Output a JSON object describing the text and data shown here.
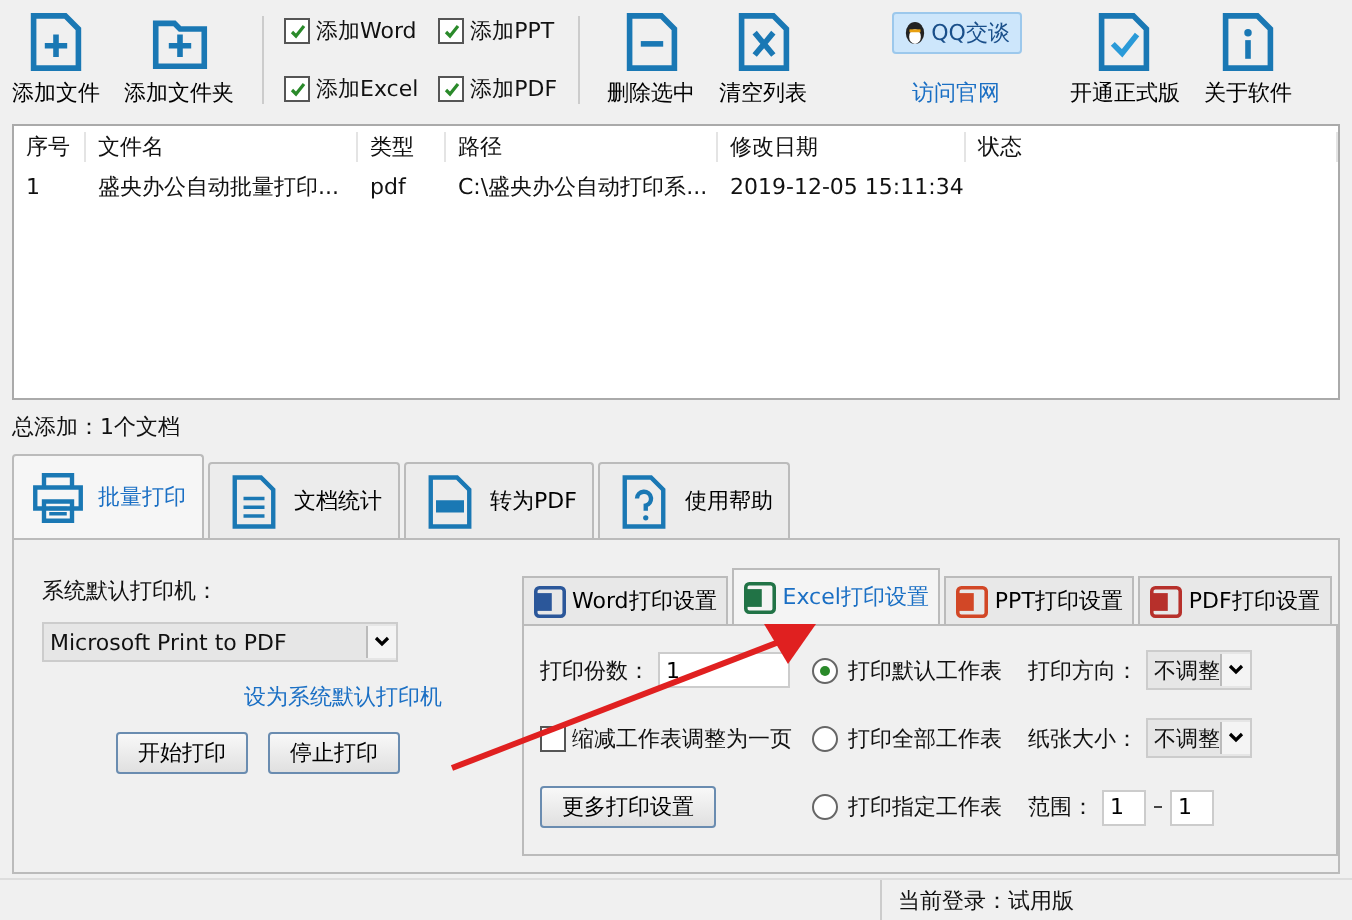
{
  "toolbar": {
    "left": [
      {
        "label": "添加文件",
        "kind": "file-plus"
      },
      {
        "label": "添加文件夹",
        "kind": "folder-plus"
      }
    ],
    "checkboxes": [
      {
        "label": "添加Word",
        "checked": true
      },
      {
        "label": "添加PPT",
        "checked": true
      },
      {
        "label": "添加Excel",
        "checked": true
      },
      {
        "label": "添加PDF",
        "checked": true
      }
    ],
    "middle": [
      {
        "label": "删除选中",
        "kind": "file-minus"
      },
      {
        "label": "清空列表",
        "kind": "file-x"
      }
    ],
    "qq": {
      "label": "QQ交谈",
      "link": "访问官网"
    },
    "right": [
      {
        "label": "开通正式版",
        "kind": "file-check"
      },
      {
        "label": "关于软件",
        "kind": "info"
      }
    ]
  },
  "table": {
    "columns": [
      "序号",
      "文件名",
      "类型",
      "路径",
      "修改日期",
      "状态"
    ],
    "rows": [
      [
        "1",
        "盛央办公自动批量打印...",
        "pdf",
        "C:\\盛央办公自动打印系...",
        "2019-12-05 15:11:34"
      ]
    ]
  },
  "summary": "总添加：1个文档",
  "main_tabs": [
    {
      "label": "批量打印",
      "kind": "printer",
      "selected": true
    },
    {
      "label": "文档统计",
      "kind": "doc",
      "selected": false
    },
    {
      "label": "转为PDF",
      "kind": "pdf",
      "selected": false
    },
    {
      "label": "使用帮助",
      "kind": "help",
      "selected": false
    }
  ],
  "printer": {
    "label": "系统默认打印机：",
    "value": "Microsoft Print to PDF",
    "link": "设为系统默认打印机",
    "buttons": [
      "开始打印",
      "停止打印"
    ]
  },
  "sub_tabs": [
    {
      "label": "Word打印设置",
      "kind": "word",
      "selected": false
    },
    {
      "label": "Excel打印设置",
      "kind": "excel",
      "selected": true
    },
    {
      "label": "PPT打印设置",
      "kind": "ppt",
      "selected": false
    },
    {
      "label": "PDF打印设置",
      "kind": "pdf",
      "selected": false
    }
  ],
  "excel": {
    "copies_label": "打印份数：",
    "copies_value": "1",
    "fit": {
      "label": "缩减工作表调整为一页",
      "checked": false
    },
    "more_button": "更多打印设置",
    "sheets": [
      {
        "label": "打印默认工作表",
        "selected": true
      },
      {
        "label": "打印全部工作表",
        "selected": false
      },
      {
        "label": "打印指定工作表",
        "selected": false
      }
    ],
    "orientation": {
      "label": "打印方向：",
      "value": "不调整"
    },
    "paper": {
      "label": "纸张大小：",
      "value": "不调整"
    },
    "range": {
      "label": "范围：",
      "from": "1",
      "to": "1"
    }
  },
  "status_bar": "当前登录：试用版"
}
